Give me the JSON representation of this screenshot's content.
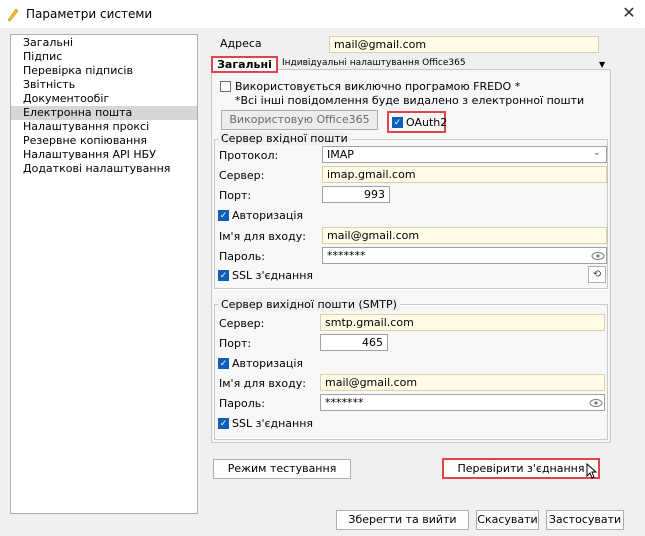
{
  "window": {
    "title": "Параметри системи",
    "close_glyph": "✕"
  },
  "nav": {
    "items": [
      "Загальні",
      "Підпис",
      "Перевірка підписів",
      "Звітність",
      "Документообіг",
      "Електронна пошта",
      "Налаштування проксі",
      "Резервне копіювання",
      "Налаштування API НБУ",
      "Додаткові налаштування"
    ],
    "selected": "Електронна пошта"
  },
  "address": {
    "label": "Адреса",
    "value": "mail@gmail.com"
  },
  "tabs": {
    "general": "Загальні",
    "individual": "Індивідуальні налаштування Office365"
  },
  "fredo": {
    "label": "Використовується виключно програмою FREDO *",
    "note": "*Всі інші повідомлення буде видалено з електронної пошти"
  },
  "office365_button": "Використовую Office365",
  "oauth2": {
    "label": "OAuth2",
    "checked": true
  },
  "incoming": {
    "title": "Сервер вхідної пошти",
    "protocol_label": "Протокол:",
    "protocol": "IMAP",
    "server_label": "Сервер:",
    "server": "imap.gmail.com",
    "port_label": "Порт:",
    "port": "993",
    "auth_label": "Авторизація",
    "login_label": "Ім'я для входу:",
    "login": "mail@gmail.com",
    "password_label": "Пароль:",
    "password": "*******",
    "ssl_label": "SSL з'єднання"
  },
  "outgoing": {
    "title": "Сервер вихідної пошти (SMTP)",
    "server_label": "Сервер:",
    "server": "smtp.gmail.com",
    "port_label": "Порт:",
    "port": "465",
    "auth_label": "Авторизація",
    "login_label": "Ім'я для входу:",
    "login": "mail@gmail.com",
    "password_label": "Пароль:",
    "password": "*******",
    "ssl_label": "SSL з'єднання"
  },
  "buttons": {
    "test_mode": "Режим тестування",
    "check_connection": "Перевірити з'єднання",
    "save_exit": "Зберегти та вийти",
    "cancel": "Скасувати",
    "apply": "Застосувати"
  },
  "colors": {
    "highlight": "#e0434b",
    "checkbox": "#0d5fb8",
    "field_bg": "#fffbe6"
  }
}
